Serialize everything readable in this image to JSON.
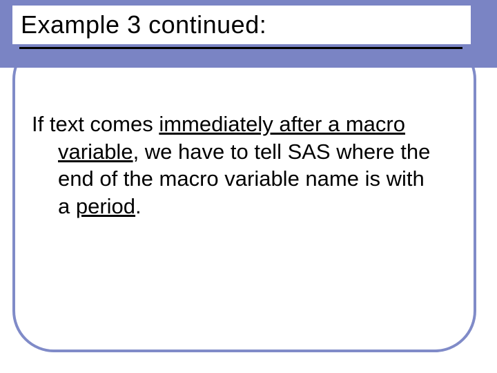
{
  "slide": {
    "title": "Example 3 continued:",
    "body": {
      "t1": "If text comes ",
      "u1": "immediately after a macro",
      "u2": "variable",
      "t2": ", we have to tell SAS where the",
      "t3": "end of the macro variable name is with",
      "t4": "a ",
      "u3": "period",
      "t5": "."
    }
  }
}
